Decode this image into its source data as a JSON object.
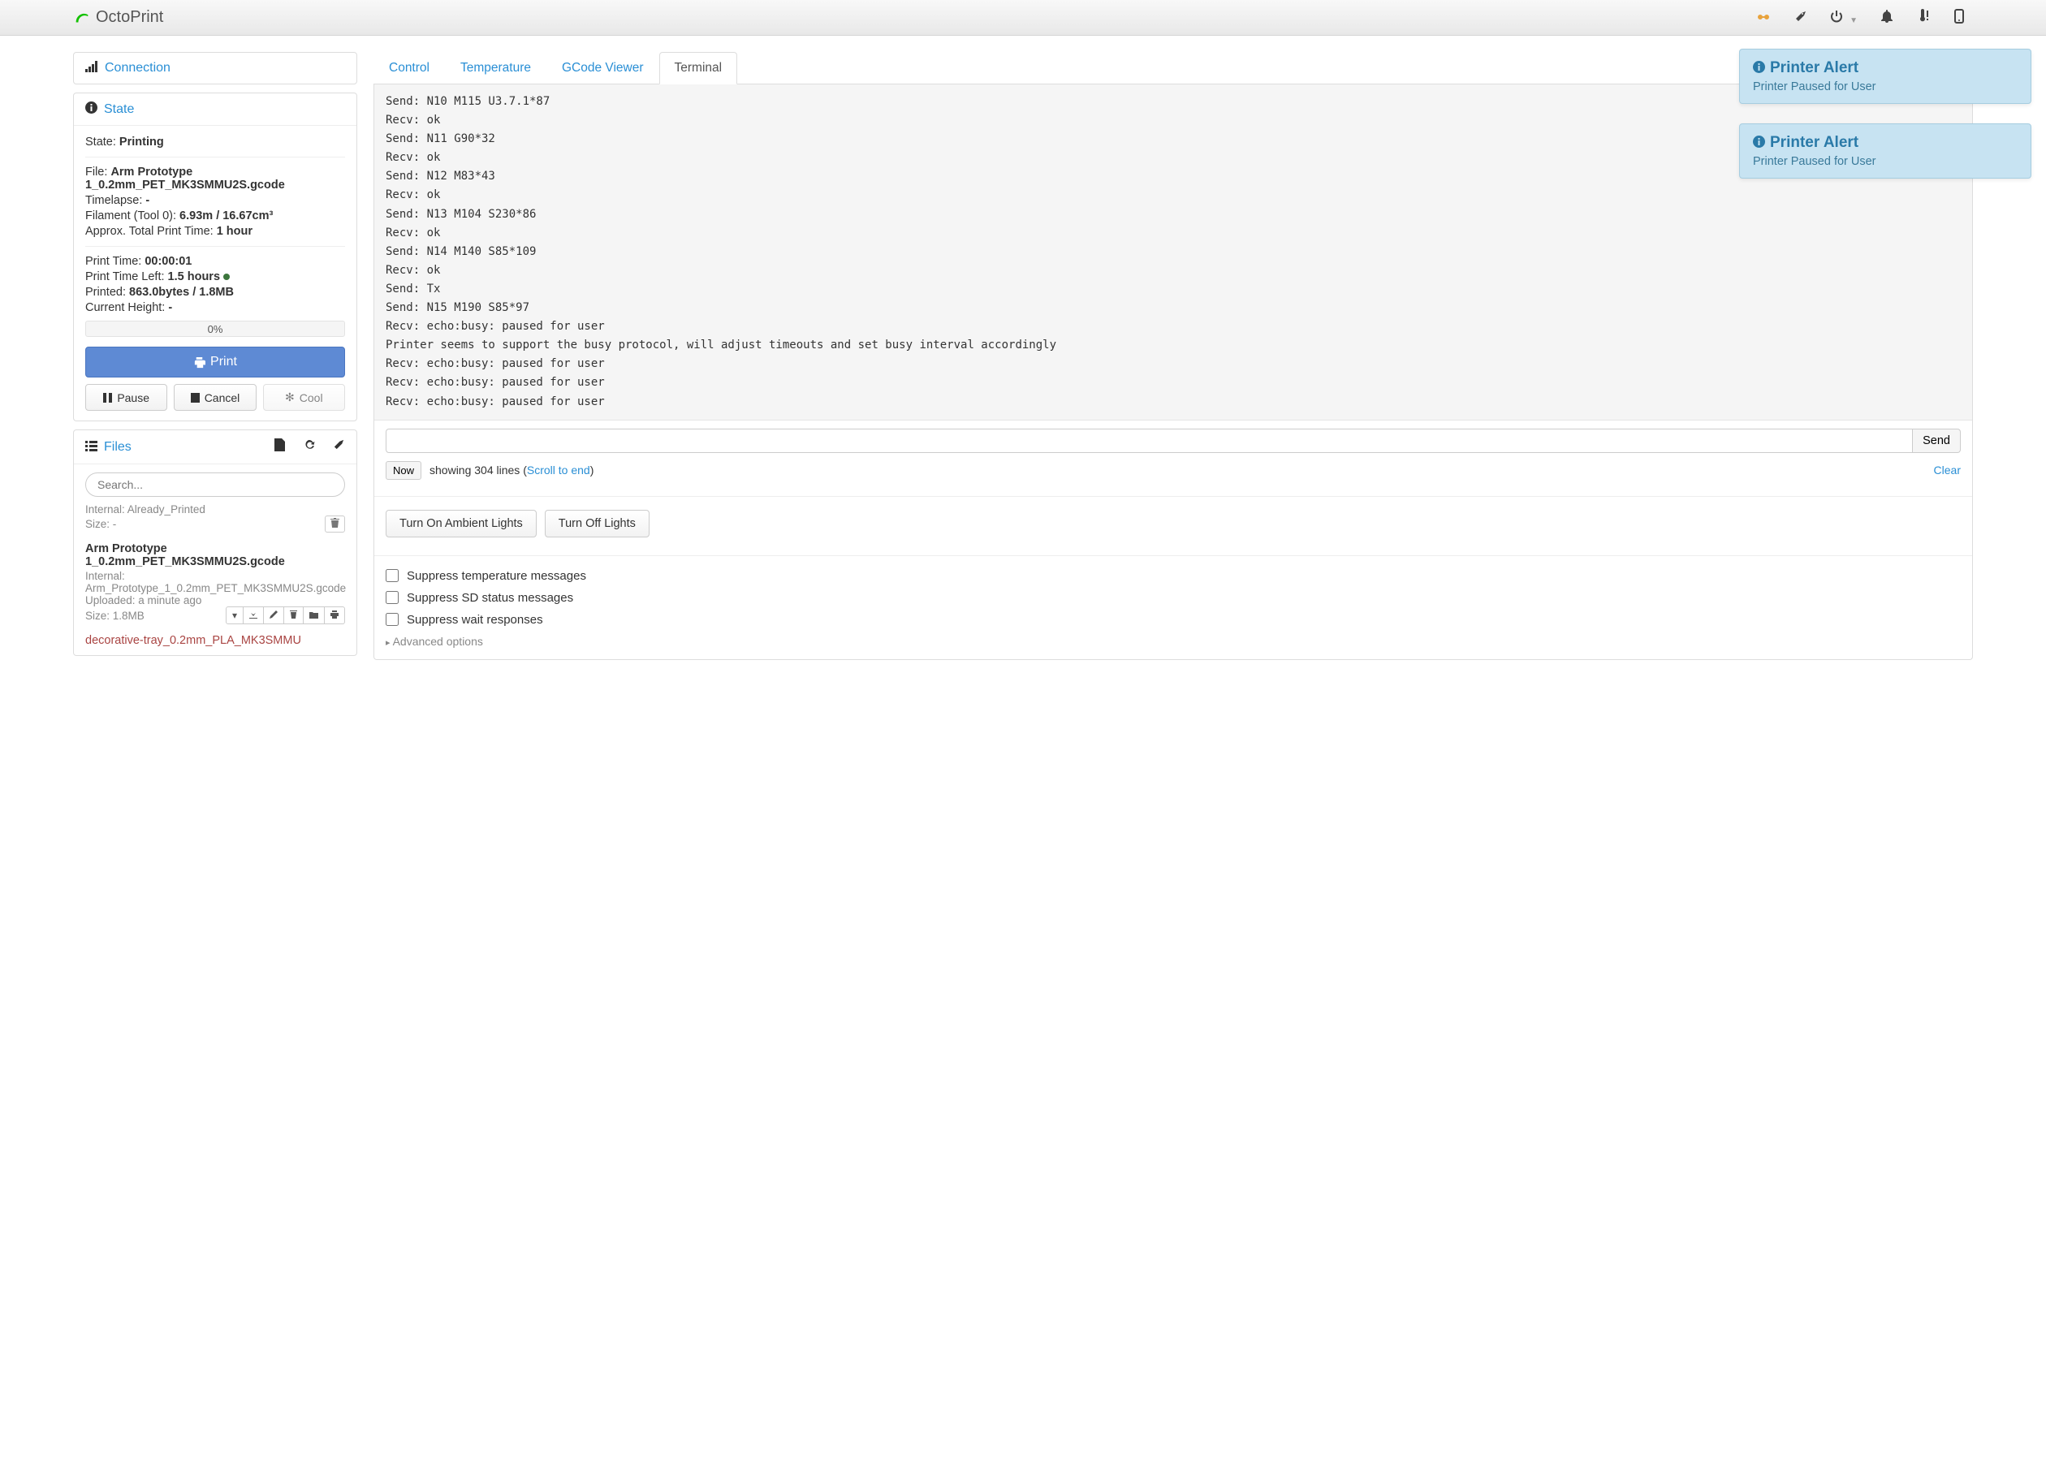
{
  "brand": "OctoPrint",
  "sidebar": {
    "connection_label": "Connection",
    "state_label": "State",
    "state": {
      "state_lbl": "State:",
      "state_val": "Printing",
      "file_lbl": "File:",
      "file_val": "Arm Prototype 1_0.2mm_PET_MK3SMMU2S.gcode",
      "timelapse_lbl": "Timelapse:",
      "timelapse_val": "-",
      "filament_lbl": "Filament (Tool 0):",
      "filament_val": "6.93m / 16.67cm³",
      "approx_lbl": "Approx. Total Print Time:",
      "approx_val": "1 hour",
      "print_time_lbl": "Print Time:",
      "print_time_val": "00:00:01",
      "print_time_left_lbl": "Print Time Left:",
      "print_time_left_val": "1.5 hours",
      "printed_lbl": "Printed:",
      "printed_val": "863.0bytes / 1.8MB",
      "height_lbl": "Current Height:",
      "height_val": "-",
      "progress": "0%",
      "btn_print": "Print",
      "btn_pause": "Pause",
      "btn_cancel": "Cancel",
      "btn_cool": "Cool"
    },
    "files": {
      "label": "Files",
      "search_placeholder": "Search...",
      "item0": {
        "internal": "Internal: Already_Printed",
        "size": "Size: -"
      },
      "item1": {
        "title": "Arm Prototype 1_0.2mm_PET_MK3SMMU2S.gcode",
        "internal": "Internal: Arm_Prototype_1_0.2mm_PET_MK3SMMU2S.gcode",
        "uploaded": "Uploaded: a minute ago",
        "size": "Size: 1.8MB"
      },
      "item2": {
        "title": "decorative-tray_0.2mm_PLA_MK3SMMU"
      }
    }
  },
  "tabs": {
    "control": "Control",
    "temperature": "Temperature",
    "gcode": "GCode Viewer",
    "terminal": "Terminal"
  },
  "terminal": {
    "output": "Send: N10 M115 U3.7.1*87\nRecv: ok\nSend: N11 G90*32\nRecv: ok\nSend: N12 M83*43\nRecv: ok\nSend: N13 M104 S230*86\nRecv: ok\nSend: N14 M140 S85*109\nRecv: ok\nSend: Tx\nSend: N15 M190 S85*97\nRecv: echo:busy: paused for user\nPrinter seems to support the busy protocol, will adjust timeouts and set busy interval accordingly\nRecv: echo:busy: paused for user\nRecv: echo:busy: paused for user\nRecv: echo:busy: paused for user",
    "send_btn": "Send",
    "now_btn": "Now",
    "showing_prefix": "showing 304 lines (",
    "scroll_link": "Scroll to end",
    "showing_suffix": ")",
    "clear": "Clear",
    "btn_lights_on": "Turn On Ambient Lights",
    "btn_lights_off": "Turn Off Lights",
    "chk_temp": "Suppress temperature messages",
    "chk_sd": "Suppress SD status messages",
    "chk_wait": "Suppress wait responses",
    "advanced": "Advanced options"
  },
  "alerts": {
    "title": "Printer Alert",
    "body": "Printer Paused for User"
  }
}
